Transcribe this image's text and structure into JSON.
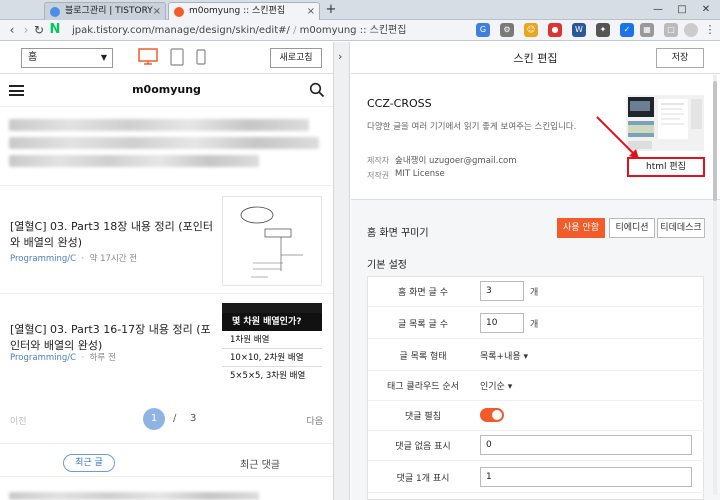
{
  "browser": {
    "tabs": [
      {
        "title": "블로그관리 | TISTORY",
        "favicon_color": "#4b8ee8",
        "active": false
      },
      {
        "title": "m0omyung :: 스킨편집",
        "favicon_color": "#f25c2a",
        "active": true
      }
    ],
    "new_tab": "+",
    "url": "jpak.tistory.com/manage/design/skin/edit#/",
    "url_suffix": "m0omyung :: 스킨편집"
  },
  "preview": {
    "page_select": "홈",
    "refresh_label": "새로고침",
    "blog_title": "m0omyung",
    "posts": [
      {
        "title": "[열혈C] 03. Part3 18장 내용 정리 (포인터와 배열의 완성)",
        "category": "Programming/C",
        "time": "약 17시간 전"
      },
      {
        "title": "[열혈C] 03. Part3 16-17장 내용 정리 (포인터와 배열의 완성)",
        "category": "Programming/C",
        "time": "하루 전"
      }
    ],
    "thumb2_lines": [
      "몇 차원 배열인가?",
      "1차원 배열",
      "10×10, 2차원 배열",
      "5×5×5, 3차원 배열"
    ],
    "pager": {
      "prev": "이전",
      "current": "1",
      "slash": "/",
      "total": "3",
      "next": "다음"
    },
    "bottom_tabs": {
      "recent": "최근 글",
      "comments": "최근 댓글"
    }
  },
  "editor": {
    "title": "스킨 편집",
    "save_label": "저장",
    "skin": {
      "name": "CCZ-CROSS",
      "desc": "다양한 글을 여러 기기에서 읽기 좋게 보여주는 스킨입니다.",
      "author_label": "제작자",
      "author": "숲내쟁이 uzugoer@gmail.com",
      "license_label": "저작권",
      "license": "MIT License",
      "html_edit_label": "html 편집"
    },
    "home": {
      "title": "홈 화면 꾸미기",
      "options": [
        "사용 안함",
        "티에디션",
        "티데데스크"
      ],
      "selected": "사용 안함"
    },
    "basic": {
      "title": "기본 설정",
      "rows": [
        {
          "label": "홈 화면 글 수",
          "type": "number",
          "value": "3",
          "unit": "개"
        },
        {
          "label": "글 목록 글 수",
          "type": "number",
          "value": "10",
          "unit": "개"
        },
        {
          "label": "글 목록 형태",
          "type": "dropdown",
          "value": "목록+내용 ▾"
        },
        {
          "label": "태그 클라우드 순서",
          "type": "dropdown",
          "value": "인기순 ▾"
        },
        {
          "label": "댓글 펼침",
          "type": "toggle",
          "on": true
        },
        {
          "label": "댓글 없음 표시",
          "type": "text",
          "value": "0"
        },
        {
          "label": "댓글 1개 표시",
          "type": "text",
          "value": "1"
        }
      ]
    }
  },
  "colors": {
    "accent": "#f25c2a",
    "highlight": "#e0121b",
    "link": "#4a7fc1"
  }
}
